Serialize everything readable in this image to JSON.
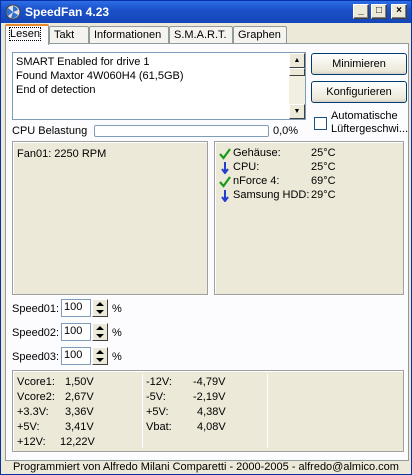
{
  "window": {
    "title": "SpeedFan 4.23"
  },
  "title_buttons": {
    "minimize": "_",
    "maximize": "□",
    "close": "×"
  },
  "tabs": [
    {
      "label": "Lesen"
    },
    {
      "label": "Takt"
    },
    {
      "label": "Informationen"
    },
    {
      "label": "S.M.A.R.T."
    },
    {
      "label": "Graphen"
    }
  ],
  "log": {
    "lines": [
      "SMART Enabled for drive 1",
      "Found Maxtor 4W060H4 (61,5GB)",
      "End of detection"
    ]
  },
  "buttons": {
    "minimize": "Minimieren",
    "configure": "Konfigurieren"
  },
  "auto_fan": {
    "label_line1": "Automatische",
    "label_line2": "Lüftergeschwi...",
    "checked": false
  },
  "cpu_usage": {
    "label": "CPU Belastung",
    "value_text": "0,0%",
    "fraction": 0.0
  },
  "fans": [
    "Fan01: 2250 RPM"
  ],
  "temps": [
    {
      "name": "Gehäuse:",
      "value": "25°C",
      "icon": "check-icon"
    },
    {
      "name": "CPU:",
      "value": "25°C",
      "icon": "arrow-down-icon"
    },
    {
      "name": "nForce 4:",
      "value": "69°C",
      "icon": "check-icon"
    },
    {
      "name": "Samsung HDD:",
      "value": "29°C",
      "icon": "arrow-down-icon"
    }
  ],
  "speeds": [
    {
      "label": "Speed01:",
      "value": "100",
      "unit": "%"
    },
    {
      "label": "Speed02:",
      "value": "100",
      "unit": "%"
    },
    {
      "label": "Speed03:",
      "value": "100",
      "unit": "%"
    }
  ],
  "voltages_left": [
    {
      "name": "Vcore1:",
      "value": "1,50V"
    },
    {
      "name": "Vcore2:",
      "value": "2,67V"
    },
    {
      "name": "+3.3V:",
      "value": "3,36V"
    },
    {
      "name": "+5V:",
      "value": "3,41V"
    },
    {
      "name": "+12V:",
      "value": "12,22V"
    }
  ],
  "voltages_right": [
    {
      "name": "-12V:",
      "value": "-4,79V"
    },
    {
      "name": "-5V:",
      "value": "-2,19V"
    },
    {
      "name": "+5V:",
      "value": "4,38V"
    },
    {
      "name": "Vbat:",
      "value": "4,08V"
    }
  ],
  "status": {
    "text": "Programmiert von Alfredo Milani Comparetti - 2000-2005 - alfredo@almico.com"
  }
}
